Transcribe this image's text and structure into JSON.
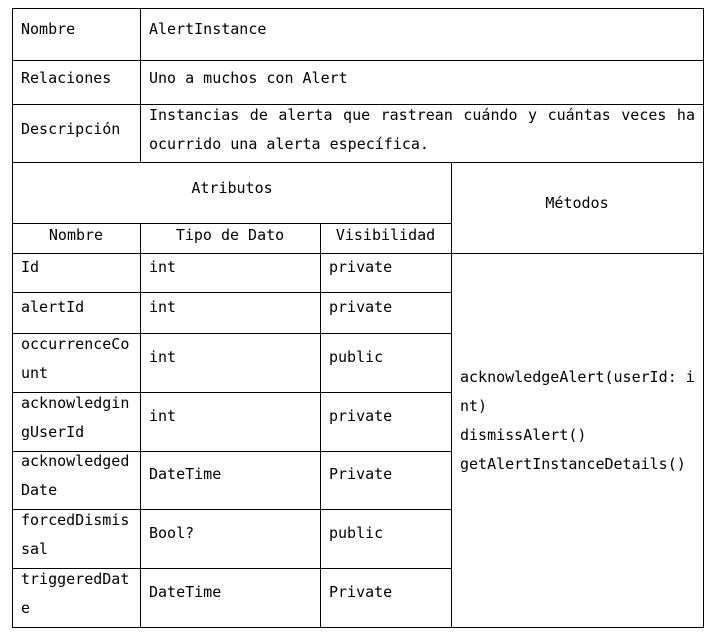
{
  "header": {
    "nombre_label": "Nombre",
    "nombre_value": "AlertInstance",
    "relaciones_label": "Relaciones",
    "relaciones_value": "Uno a muchos con Alert",
    "descripcion_label": "Descripción",
    "descripcion_value": "Instancias de alerta que rastrean cuándo y cuántas veces ha ocurrido una alerta específica."
  },
  "atributos": {
    "title": "Atributos",
    "columns": [
      "Nombre",
      "Tipo de Dato",
      "Visibilidad"
    ],
    "rows": [
      [
        "Id",
        "int",
        "private"
      ],
      [
        "alertId",
        "int",
        "private"
      ],
      [
        "occurrenceCount",
        "int",
        "public"
      ],
      [
        "acknowledgingUserId",
        "int",
        "private"
      ],
      [
        "acknowledgedDate",
        "DateTime",
        "Private"
      ],
      [
        "forcedDismissal",
        "Bool?",
        "public"
      ],
      [
        "triggeredDate",
        "DateTime",
        "Private"
      ]
    ]
  },
  "metodos": {
    "title": "Métodos",
    "items": [
      "acknowledgeAlert(userId: int)",
      "dismissAlert()",
      "getAlertInstanceDetails()"
    ]
  }
}
